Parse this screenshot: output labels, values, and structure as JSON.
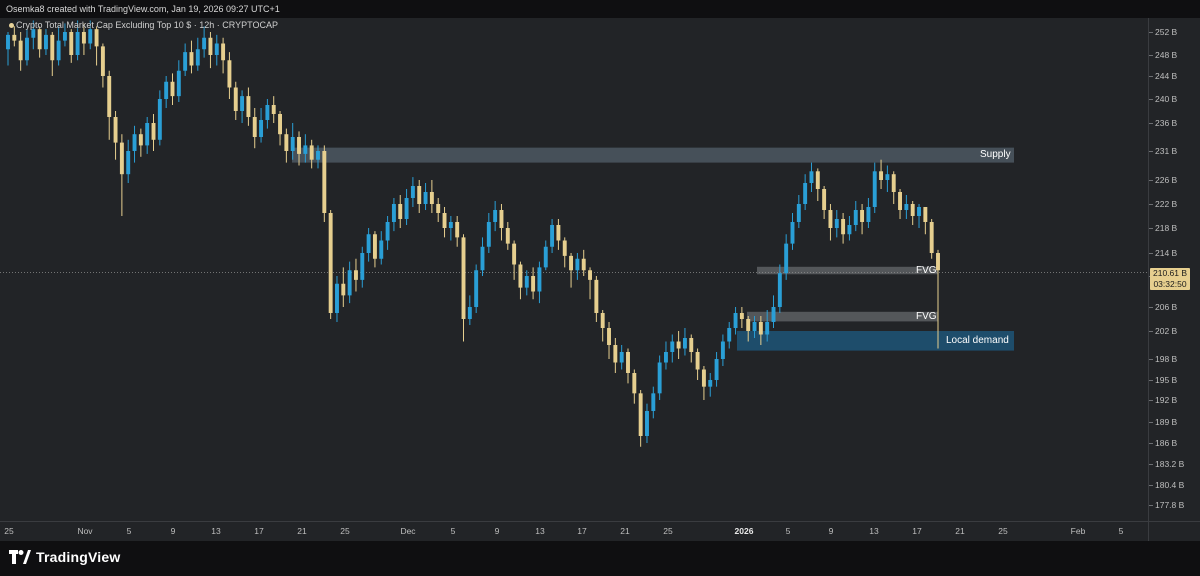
{
  "header": {
    "text": "Osemka8 created with TradingView.com, Jan 19, 2026 09:27 UTC+1"
  },
  "symbol": {
    "legend": "Crypto Total Market Cap Excluding Top 10 $ · 12h · CRYPTOCAP"
  },
  "price_axis": {
    "ticks": [
      "252 B",
      "248 B",
      "244 B",
      "240 B",
      "236 B",
      "231 B",
      "226 B",
      "222 B",
      "218 B",
      "214 B",
      "210 B",
      "206 B",
      "202 B",
      "198 B",
      "195 B",
      "192 B",
      "189 B",
      "186 B",
      "183.2 B",
      "180.4 B",
      "177.8 B"
    ]
  },
  "last_price": {
    "value": "210.61 B",
    "countdown": "03:32:50"
  },
  "time_axis": {
    "ticks": [
      "25",
      "Nov",
      "5",
      "9",
      "13",
      "17",
      "21",
      "25",
      "Dec",
      "5",
      "9",
      "13",
      "17",
      "21",
      "25",
      "2026",
      "5",
      "9",
      "13",
      "17",
      "21",
      "25",
      "Feb",
      "5"
    ]
  },
  "zones": {
    "supply": "Supply",
    "fvg_upper": "FVG",
    "fvg_lower": "FVG",
    "demand": "Local demand"
  },
  "footer": {
    "brand": "TradingView"
  },
  "colors": {
    "up_candle": "#2a9fd6",
    "down_candle": "#e6cf8f",
    "background": "#222427",
    "supply_zone": "#4c5863",
    "fvg_zone": "#5a5d61",
    "demand_zone": "#1e5273"
  },
  "chart_data": {
    "type": "candlestick",
    "title": "Crypto Total Market Cap Excluding Top 10 $",
    "interval": "12h",
    "unit": "B USD",
    "ylim": [
      176,
      254
    ],
    "last_price": 210.61,
    "zones": [
      {
        "name": "Supply",
        "from": 229.0,
        "to": 231.6
      },
      {
        "name": "FVG",
        "from": 210.3,
        "to": 211.6
      },
      {
        "name": "FVG",
        "from": 203.6,
        "to": 205.2
      },
      {
        "name": "Local demand",
        "from": 199.2,
        "to": 202.0
      }
    ],
    "candles": [
      [
        249.0,
        251.5,
        252.0,
        246.0
      ],
      [
        251.5,
        250.5,
        253.0,
        249.5
      ],
      [
        250.5,
        247.0,
        252.0,
        245.0
      ],
      [
        247.0,
        251.0,
        252.5,
        246.0
      ],
      [
        251.0,
        252.5,
        254.0,
        249.0
      ],
      [
        252.5,
        249.0,
        253.0,
        247.5
      ],
      [
        249.0,
        251.5,
        252.5,
        248.0
      ],
      [
        251.5,
        247.0,
        252.0,
        244.0
      ],
      [
        247.0,
        250.5,
        253.0,
        246.0
      ],
      [
        250.5,
        252.0,
        253.5,
        249.5
      ],
      [
        252.0,
        248.0,
        252.5,
        246.5
      ],
      [
        248.0,
        252.0,
        254.0,
        247.0
      ],
      [
        252.0,
        250.0,
        253.5,
        248.0
      ],
      [
        250.0,
        252.5,
        254.0,
        249.0
      ],
      [
        252.5,
        249.5,
        253.0,
        246.0
      ],
      [
        249.5,
        244.0,
        250.0,
        242.0
      ],
      [
        244.0,
        237.0,
        245.0,
        233.0
      ],
      [
        237.0,
        232.5,
        238.0,
        229.5
      ],
      [
        232.5,
        227.0,
        234.0,
        220.0
      ],
      [
        227.0,
        231.0,
        233.0,
        225.5
      ],
      [
        231.0,
        234.0,
        235.5,
        229.0
      ],
      [
        234.0,
        232.0,
        235.0,
        230.0
      ],
      [
        232.0,
        236.0,
        237.0,
        230.5
      ],
      [
        236.0,
        233.0,
        237.5,
        231.0
      ],
      [
        233.0,
        240.0,
        241.5,
        232.0
      ],
      [
        240.0,
        243.0,
        244.0,
        238.5
      ],
      [
        243.0,
        240.5,
        244.5,
        239.0
      ],
      [
        240.5,
        245.0,
        247.0,
        239.5
      ],
      [
        245.0,
        248.5,
        250.0,
        244.0
      ],
      [
        248.5,
        246.0,
        250.5,
        244.5
      ],
      [
        246.0,
        249.0,
        251.0,
        245.0
      ],
      [
        249.0,
        251.0,
        253.0,
        247.5
      ],
      [
        251.0,
        248.0,
        252.0,
        245.5
      ],
      [
        248.0,
        250.0,
        251.5,
        246.0
      ],
      [
        250.0,
        247.0,
        251.0,
        244.5
      ],
      [
        247.0,
        242.0,
        248.5,
        240.0
      ],
      [
        242.0,
        238.0,
        243.0,
        236.5
      ],
      [
        238.0,
        240.5,
        241.5,
        236.0
      ],
      [
        240.5,
        237.0,
        242.0,
        235.5
      ],
      [
        237.0,
        233.5,
        238.5,
        231.5
      ],
      [
        233.5,
        236.5,
        238.5,
        232.5
      ],
      [
        236.5,
        239.0,
        240.0,
        235.0
      ],
      [
        239.0,
        237.5,
        240.5,
        236.0
      ],
      [
        237.5,
        234.0,
        238.0,
        232.0
      ],
      [
        234.0,
        231.0,
        235.0,
        229.0
      ],
      [
        231.0,
        233.5,
        236.0,
        229.5
      ],
      [
        233.5,
        230.5,
        234.5,
        228.5
      ],
      [
        230.5,
        232.0,
        234.0,
        229.0
      ],
      [
        232.0,
        229.5,
        233.0,
        228.0
      ],
      [
        229.5,
        231.0,
        232.0,
        228.0
      ],
      [
        231.0,
        220.5,
        232.0,
        219.0
      ],
      [
        220.5,
        205.0,
        221.0,
        204.0
      ],
      [
        205.0,
        209.0,
        210.0,
        203.5
      ],
      [
        209.0,
        207.5,
        211.5,
        206.0
      ],
      [
        207.5,
        211.0,
        212.5,
        206.5
      ],
      [
        211.0,
        209.5,
        213.0,
        208.0
      ],
      [
        209.5,
        214.0,
        215.0,
        208.5
      ],
      [
        214.0,
        217.0,
        218.0,
        212.5
      ],
      [
        217.0,
        213.0,
        217.5,
        211.5
      ],
      [
        213.0,
        216.0,
        217.5,
        212.0
      ],
      [
        216.0,
        219.0,
        220.0,
        214.5
      ],
      [
        219.0,
        222.0,
        223.0,
        217.5
      ],
      [
        222.0,
        219.5,
        223.5,
        218.0
      ],
      [
        219.5,
        223.0,
        224.5,
        218.5
      ],
      [
        223.0,
        225.0,
        226.5,
        221.5
      ],
      [
        225.0,
        222.0,
        226.0,
        220.5
      ],
      [
        222.0,
        224.0,
        225.5,
        221.0
      ],
      [
        224.0,
        222.0,
        226.0,
        220.5
      ],
      [
        222.0,
        220.5,
        223.0,
        219.0
      ],
      [
        220.5,
        218.0,
        221.5,
        216.5
      ],
      [
        218.0,
        219.0,
        220.0,
        216.0
      ],
      [
        219.0,
        216.5,
        220.0,
        215.0
      ],
      [
        216.5,
        204.0,
        217.0,
        200.5
      ],
      [
        204.0,
        206.0,
        207.5,
        203.0
      ],
      [
        206.0,
        211.0,
        212.0,
        205.0
      ],
      [
        211.0,
        215.0,
        216.5,
        210.0
      ],
      [
        215.0,
        219.0,
        220.5,
        214.0
      ],
      [
        219.0,
        221.0,
        222.5,
        217.5
      ],
      [
        221.0,
        218.0,
        222.0,
        216.0
      ],
      [
        218.0,
        215.5,
        219.0,
        214.5
      ],
      [
        215.5,
        212.0,
        216.0,
        209.5
      ],
      [
        212.0,
        208.5,
        212.5,
        207.0
      ],
      [
        208.5,
        210.0,
        211.0,
        207.5
      ],
      [
        210.0,
        208.0,
        211.5,
        207.0
      ],
      [
        208.0,
        211.5,
        212.5,
        206.5
      ],
      [
        211.5,
        215.0,
        216.0,
        211.0
      ],
      [
        215.0,
        218.5,
        219.5,
        214.0
      ],
      [
        218.5,
        216.0,
        219.5,
        214.5
      ],
      [
        216.0,
        213.5,
        216.5,
        211.5
      ],
      [
        213.5,
        211.0,
        214.0,
        208.5
      ],
      [
        211.0,
        213.0,
        214.0,
        209.5
      ],
      [
        213.0,
        211.0,
        214.5,
        210.0
      ],
      [
        211.0,
        209.5,
        211.5,
        207.0
      ],
      [
        209.5,
        205.0,
        210.0,
        203.5
      ],
      [
        205.0,
        202.5,
        205.5,
        200.5
      ],
      [
        202.5,
        200.0,
        203.5,
        198.0
      ],
      [
        200.0,
        197.5,
        201.0,
        196.0
      ],
      [
        197.5,
        199.0,
        200.0,
        196.5
      ],
      [
        199.0,
        196.0,
        199.5,
        194.5
      ],
      [
        196.0,
        193.0,
        196.5,
        191.5
      ],
      [
        193.0,
        187.0,
        193.5,
        185.5
      ],
      [
        187.0,
        190.5,
        191.5,
        186.0
      ],
      [
        190.5,
        193.0,
        194.0,
        189.5
      ],
      [
        193.0,
        197.5,
        198.5,
        192.0
      ],
      [
        197.5,
        199.0,
        200.5,
        196.5
      ],
      [
        199.0,
        200.5,
        201.5,
        197.5
      ],
      [
        200.5,
        199.5,
        202.0,
        198.0
      ],
      [
        199.5,
        201.0,
        202.5,
        198.5
      ],
      [
        201.0,
        199.0,
        201.5,
        197.5
      ],
      [
        199.0,
        196.5,
        199.5,
        195.0
      ],
      [
        196.5,
        194.0,
        197.0,
        192.0
      ],
      [
        194.0,
        195.0,
        196.0,
        192.5
      ],
      [
        195.0,
        198.0,
        199.0,
        194.0
      ],
      [
        198.0,
        200.5,
        201.5,
        197.0
      ],
      [
        200.5,
        202.5,
        203.5,
        199.5
      ],
      [
        202.5,
        205.0,
        206.0,
        201.5
      ],
      [
        205.0,
        204.0,
        206.0,
        202.5
      ],
      [
        204.0,
        202.0,
        204.5,
        200.5
      ],
      [
        202.0,
        203.5,
        204.5,
        201.0
      ],
      [
        203.5,
        201.5,
        204.5,
        200.0
      ],
      [
        201.5,
        203.5,
        205.5,
        200.5
      ],
      [
        203.5,
        206.0,
        207.5,
        202.5
      ],
      [
        206.0,
        210.5,
        212.0,
        205.0
      ],
      [
        210.5,
        215.5,
        217.0,
        209.5
      ],
      [
        215.5,
        219.0,
        220.5,
        214.5
      ],
      [
        219.0,
        222.0,
        223.5,
        218.0
      ],
      [
        222.0,
        225.5,
        227.0,
        221.0
      ],
      [
        225.5,
        227.5,
        229.0,
        224.0
      ],
      [
        227.5,
        224.5,
        228.0,
        222.5
      ],
      [
        224.5,
        221.0,
        225.0,
        219.5
      ],
      [
        221.0,
        218.0,
        222.0,
        216.0
      ],
      [
        218.0,
        219.5,
        221.0,
        216.5
      ],
      [
        219.5,
        217.0,
        220.5,
        215.5
      ],
      [
        217.0,
        218.5,
        220.0,
        216.0
      ],
      [
        218.5,
        221.0,
        222.5,
        217.5
      ],
      [
        221.0,
        219.0,
        222.0,
        217.0
      ],
      [
        219.0,
        221.5,
        223.0,
        218.0
      ],
      [
        221.5,
        227.5,
        229.0,
        220.5
      ],
      [
        227.5,
        226.0,
        229.5,
        224.5
      ],
      [
        226.0,
        227.0,
        228.5,
        224.0
      ],
      [
        227.0,
        224.0,
        227.5,
        222.0
      ],
      [
        224.0,
        221.0,
        224.5,
        219.5
      ],
      [
        221.0,
        222.0,
        223.5,
        219.5
      ],
      [
        222.0,
        220.0,
        222.5,
        218.5
      ],
      [
        220.0,
        221.5,
        222.0,
        218.0
      ],
      [
        221.5,
        219.0,
        221.5,
        217.0
      ],
      [
        219.0,
        214.0,
        219.5,
        213.0
      ],
      [
        214.0,
        211.0,
        214.5,
        199.5
      ]
    ]
  }
}
